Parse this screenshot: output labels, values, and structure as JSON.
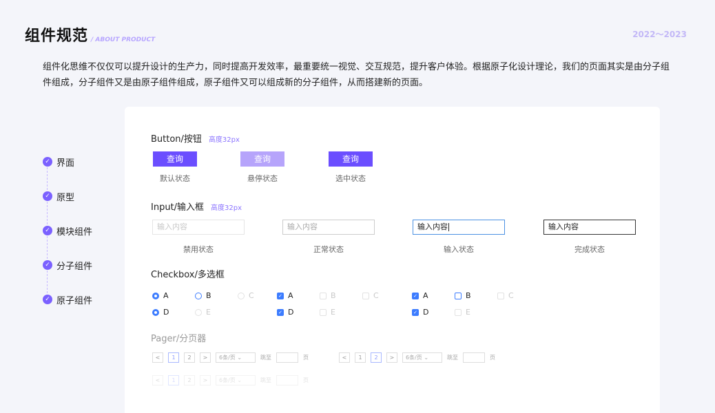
{
  "header": {
    "title": "组件规范",
    "subtitle": "/ ABOUT PRODUCT",
    "year": "2022～2023"
  },
  "intro": "组件化思维不仅仅可以提升设计的生产力，同时提高开发效率，最重要统一视觉、交互规范，提升客户体验。根据原子化设计理论，我们的页面其实是由分子组件组成，分子组件又是由原子组件组成，原子组件又可以组成新的分子组件，从而搭建新的页面。",
  "steps": [
    "界面",
    "原型",
    "模块组件",
    "分子组件",
    "原子组件"
  ],
  "check_glyph": "✓",
  "button_section": {
    "title": "Button/按钮",
    "tag": "高度32px",
    "label": "查询",
    "states": [
      "默认状态",
      "悬停状态",
      "选中状态"
    ]
  },
  "input_section": {
    "title": "Input/输入框",
    "tag": "高度32px",
    "placeholder": "输入内容",
    "states": [
      "禁用状态",
      "正常状态",
      "输入状态",
      "完成状态"
    ]
  },
  "checkbox_section": {
    "title": "Checkbox/多选框",
    "labels": [
      "A",
      "B",
      "C",
      "D",
      "E"
    ]
  },
  "pager_section": {
    "title": "Pager/分页器",
    "prev": "<",
    "next": ">",
    "pages": [
      "1",
      "2"
    ],
    "page_size": "6条/页 ⌄",
    "jump_label": "跳至",
    "page_unit": "页"
  },
  "colors": {
    "accent": "#6b4eff",
    "hover": "#b6a4fb",
    "blue": "#3c7cff"
  }
}
